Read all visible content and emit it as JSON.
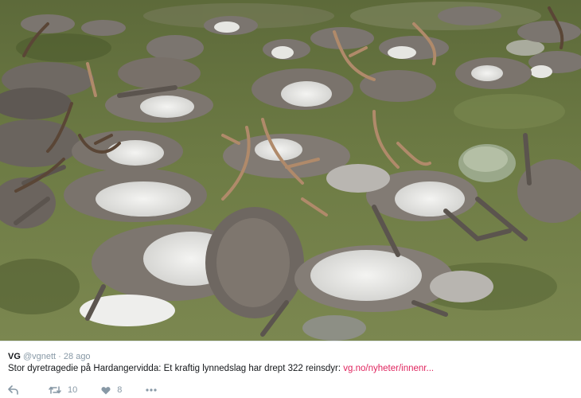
{
  "photo": {
    "alt_icon": "reindeer-photo"
  },
  "tweet": {
    "author_name": "VG",
    "author_handle": "@vgnett",
    "separator": "·",
    "time": "28 ago",
    "text": "Stor dyretragedie på Hardangervidda: Et kraftig lynnedslag har drept 322 reinsdyr: ",
    "link_text": "vg.no/nyheter/innenr...",
    "actions": {
      "reply_icon": "reply-icon",
      "retweet_icon": "retweet-icon",
      "retweet_count": "10",
      "like_icon": "heart-icon",
      "like_count": "8",
      "more_icon": "more-icon"
    }
  },
  "colors": {
    "link": "#e0245e",
    "meta": "#8899a6",
    "text": "#14171a"
  }
}
